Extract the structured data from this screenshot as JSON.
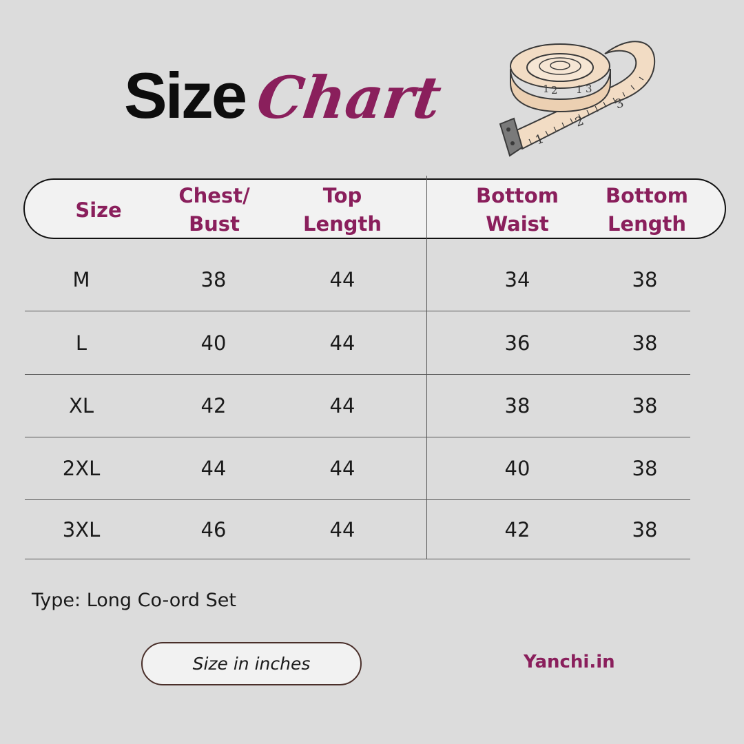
{
  "title": {
    "main": "Size",
    "script": "Chart"
  },
  "colors": {
    "accent": "#8a1f5c",
    "background": "#dcdcdc",
    "pill": "#f2f2f2",
    "tape": "#f2dcc4"
  },
  "icon": "measuring-tape-icon",
  "table": {
    "headers": [
      "Size",
      "Chest/\nBust",
      "Top\nLength",
      "Bottom\nWaist",
      "Bottom\nLength"
    ],
    "rows": [
      [
        "M",
        "38",
        "44",
        "34",
        "38"
      ],
      [
        "L",
        "40",
        "44",
        "36",
        "38"
      ],
      [
        "XL",
        "42",
        "44",
        "38",
        "38"
      ],
      [
        "2XL",
        "44",
        "44",
        "40",
        "38"
      ],
      [
        "3XL",
        "46",
        "44",
        "42",
        "38"
      ]
    ]
  },
  "footer": {
    "type_text": "Type: Long Co-ord Set",
    "unit_note": "Size in inches",
    "brand": "Yanchi.in"
  }
}
